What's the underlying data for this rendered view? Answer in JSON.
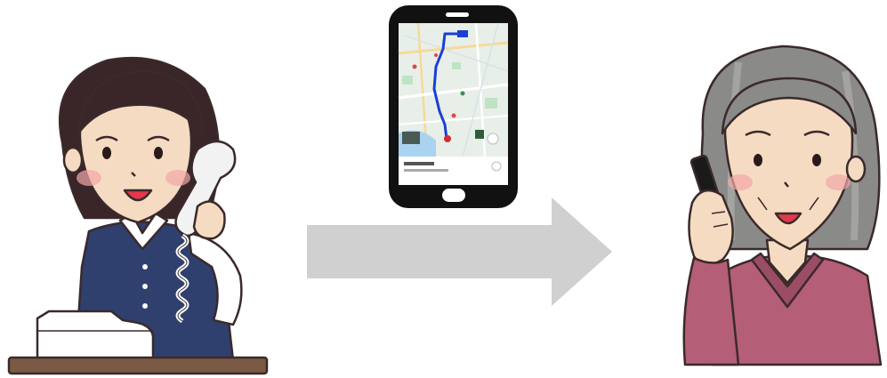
{
  "scene": {
    "left_figure": "operator-woman-on-phone-icon",
    "right_figure": "elderly-woman-on-phone-icon",
    "device": "smartphone-map-icon",
    "arrow": "arrow-right-icon"
  },
  "phone_screen": {
    "map_text": "",
    "bottom_card_text": "",
    "bottom_card_sub": ""
  },
  "colors": {
    "arrow": "#d0d0d0",
    "phone_frame": "#111111",
    "map_background": "#e8efe8",
    "route": "#1a3fd6",
    "operator_vest": "#2f3f6e",
    "elder_cardigan": "#b45e78",
    "hair_dark": "#3a2529",
    "hair_grey": "#8a8a88",
    "skin": "#f6dbc3",
    "desk": "#7a5a45"
  }
}
